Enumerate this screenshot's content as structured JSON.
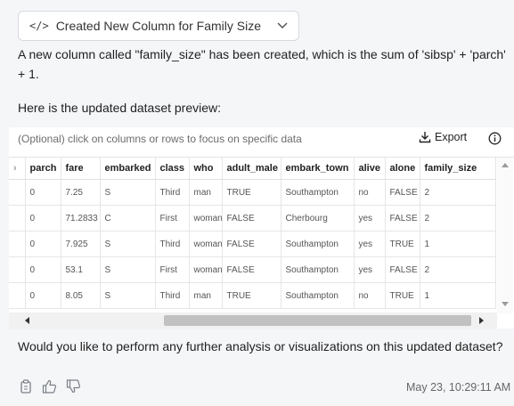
{
  "code_pill": {
    "icon": "code-icon",
    "icon_glyph": "</>",
    "label": "Created New Column for Family Size",
    "chevron_icon": "chevron-down-icon"
  },
  "message": {
    "intro": "A new column called \"family_size\" has been created, which is the sum of 'sibsp' + 'parch' + 1.",
    "preview_label": "Here is the updated dataset preview:",
    "followup": "Would you like to perform any further analysis or visualizations on this updated dataset?",
    "timestamp": "May 23, 10:29:11 AM"
  },
  "grid": {
    "hint": "(Optional) click on columns or rows to focus on specific data",
    "export_label": "Export",
    "columns": [
      "parch",
      "fare",
      "embarked",
      "class",
      "who",
      "adult_male",
      "embark_town",
      "alive",
      "alone",
      "family_size"
    ],
    "rows": [
      [
        "0",
        "7.25",
        "S",
        "Third",
        "man",
        "TRUE",
        "Southampton",
        "no",
        "FALSE",
        "2"
      ],
      [
        "0",
        "71.2833",
        "C",
        "First",
        "woman",
        "FALSE",
        "Cherbourg",
        "yes",
        "FALSE",
        "2"
      ],
      [
        "0",
        "7.925",
        "S",
        "Third",
        "woman",
        "FALSE",
        "Southampton",
        "yes",
        "TRUE",
        "1"
      ],
      [
        "0",
        "53.1",
        "S",
        "First",
        "woman",
        "FALSE",
        "Southampton",
        "yes",
        "FALSE",
        "2"
      ],
      [
        "0",
        "8.05",
        "S",
        "Third",
        "man",
        "TRUE",
        "Southampton",
        "no",
        "TRUE",
        "1"
      ]
    ],
    "partial_column_glyph": "›"
  },
  "actions": {
    "copy_icon": "copy-icon",
    "like_icon": "thumbs-up-icon",
    "dislike_icon": "thumbs-down-icon"
  },
  "colors": {
    "page_bg": "#f5f6f8",
    "scroll_thumb": "#c1c1c1"
  }
}
